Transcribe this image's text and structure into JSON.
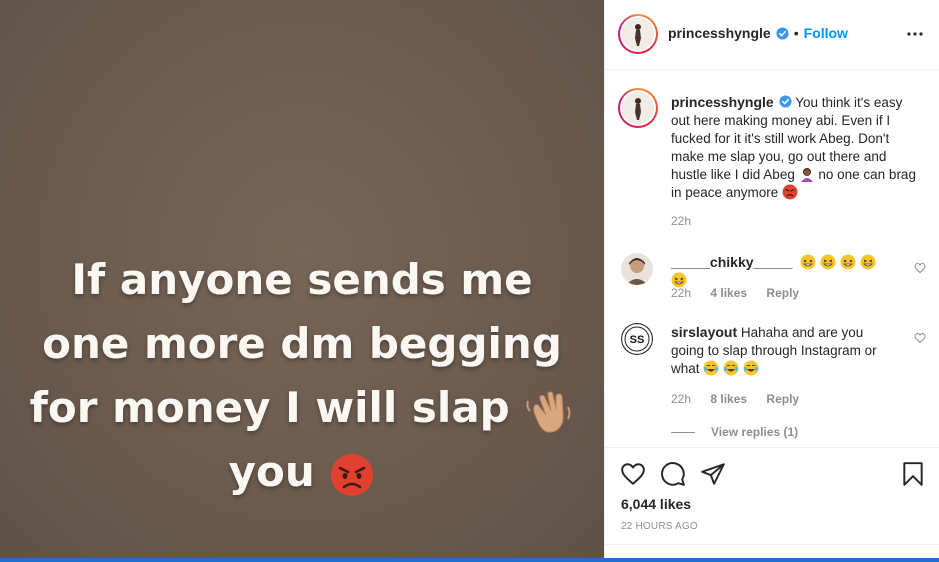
{
  "post": {
    "image_text_lines": [
      "If anyone sends me",
      "one more dm begging",
      "for money I will slap",
      "you"
    ],
    "image_emojis": [
      "waving-hand-emoji",
      "angry-face-emoji"
    ]
  },
  "header": {
    "username": "princesshyngle",
    "separator": "•",
    "follow_label": "Follow",
    "more_icon": "more-options-icon"
  },
  "caption": {
    "username": "princesshyngle",
    "text_part1": "You think it's easy out here making money abi. Even if I fucked for it it's still work Abeg. Don't make me slap you, go out there and hustle like I did Abeg",
    "text_part2": "no one can brag in peace anymore",
    "time": "22h"
  },
  "comments": [
    {
      "username": "_____chikky_____",
      "text": "",
      "emojis": [
        "grinning",
        "grinning",
        "grinning",
        "grinning",
        "grinning"
      ],
      "time": "22h",
      "likes": "4 likes",
      "reply": "Reply"
    },
    {
      "username": "sirslayout",
      "text": "Hahaha and are you going to slap through Instagram or what",
      "emojis": [
        "joy",
        "joy",
        "joy"
      ],
      "time": "22h",
      "likes": "8 likes",
      "reply": "Reply"
    }
  ],
  "view_replies": "View replies (1)",
  "actions": {
    "likes": "6,044 likes",
    "time": "22 HOURS AGO"
  },
  "colors": {
    "accent": "#0095f6",
    "media_bg": "#6f5f52",
    "muted": "#8e8e8e"
  }
}
